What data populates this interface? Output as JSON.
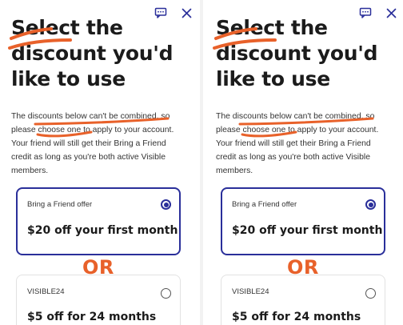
{
  "panels": [
    {
      "title_lines": [
        "Select the",
        "discount you'd",
        "like to use"
      ],
      "description_lines": [
        "The discounts below can't be combined, so",
        "please choose one to apply to your account.",
        "Your friend will still get their Bring a Friend",
        "credit as long as you're both active Visible",
        "members."
      ],
      "offers": [
        {
          "label": "Bring a Friend offer",
          "offer": "$20 off your first month",
          "selected": true
        },
        {
          "label": "VISIBLE24",
          "offer": "$5 off for 24 months",
          "selected": false
        }
      ],
      "or_text": "OR"
    },
    {
      "title_lines": [
        "Select the",
        "discount you'd",
        "like to use"
      ],
      "description_lines": [
        "The discounts below can't be combined, so",
        "please choose one to apply to your account.",
        "Your friend will still get their Bring a Friend",
        "credit as long as you're both active Visible",
        "members."
      ],
      "offers": [
        {
          "label": "Bring a Friend offer",
          "offer": "$20 off your first month",
          "selected": true
        },
        {
          "label": "VISIBLE24",
          "offer": "$5 off for 24 months",
          "selected": false
        }
      ],
      "or_text": "OR"
    }
  ],
  "icons": {
    "chat": "chat-icon",
    "close": "close-icon"
  },
  "colors": {
    "accent": "#2a2f9a",
    "annotation": "#e8612a",
    "text": "#1b1b1b"
  }
}
